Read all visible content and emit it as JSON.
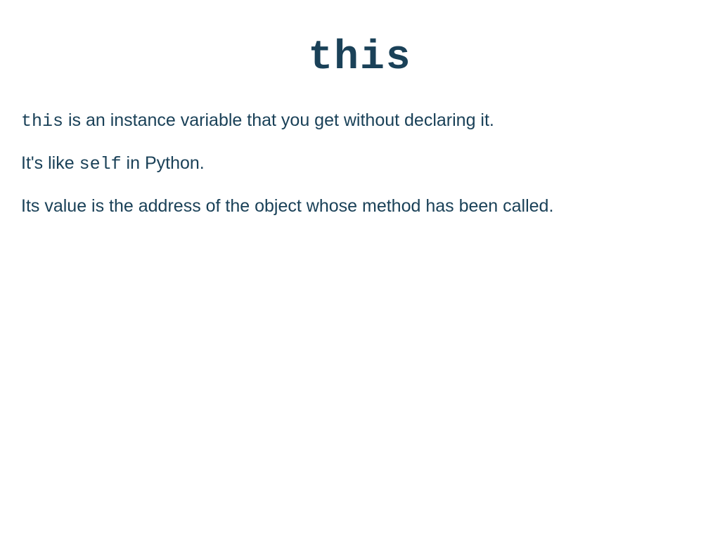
{
  "slide": {
    "title": "this",
    "p1": {
      "code": "this",
      "text": " is an instance variable that you get without declaring it."
    },
    "p2": {
      "prefix": "It's like ",
      "code": "self",
      "suffix": " in Python."
    },
    "p3": "Its value is the address of the object whose method has been called."
  }
}
